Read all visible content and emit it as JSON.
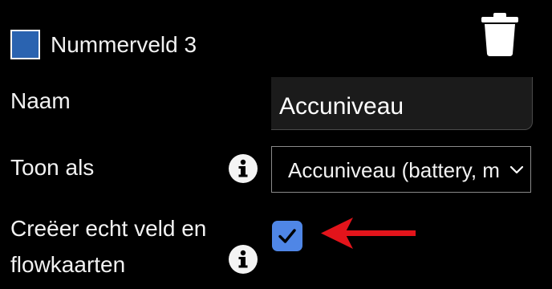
{
  "header": {
    "field_title": "Nummerveld 3",
    "swatch_color": "#2a63b0",
    "delete_icon": "trash-icon"
  },
  "form": {
    "name_label": "Naam",
    "name_value": "Accuniveau",
    "show_as_label": "Toon als",
    "show_as_selected": "Accuniveau (battery, measure_battery)",
    "create_label_line1": "Creëer echt veld en",
    "create_label_line2": "flowkaarten",
    "create_checked": true,
    "info_icon": "info-icon"
  },
  "annotation": {
    "arrow_color": "#e3141b"
  },
  "colors": {
    "background": "#000000",
    "checkbox_accent": "#4f86e6"
  }
}
